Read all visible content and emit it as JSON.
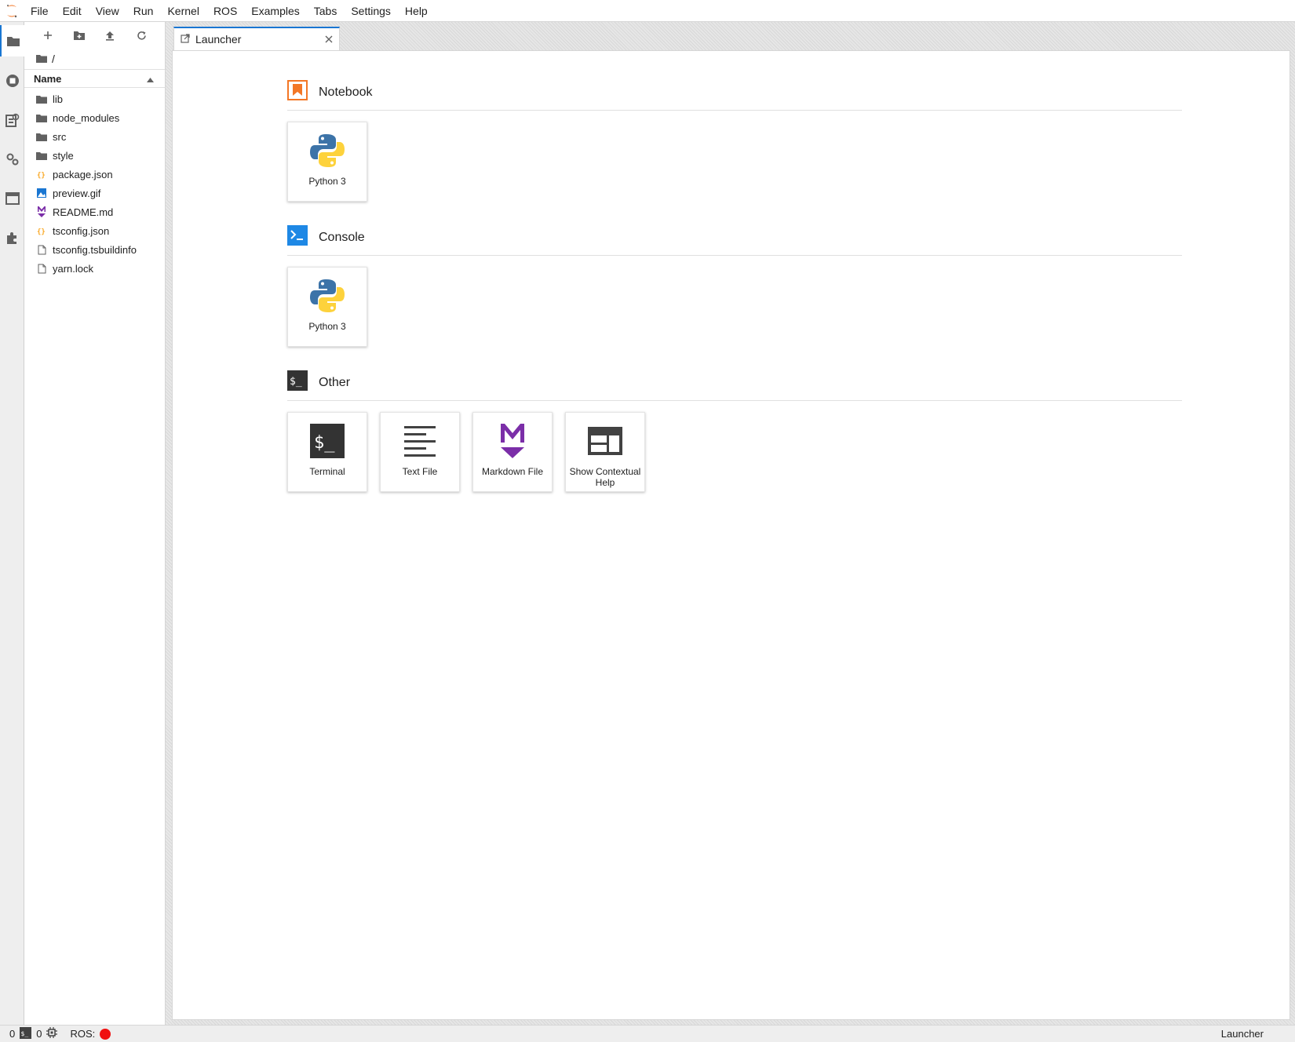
{
  "menubar": {
    "items": [
      "File",
      "Edit",
      "View",
      "Run",
      "Kernel",
      "ROS",
      "Examples",
      "Tabs",
      "Settings",
      "Help"
    ]
  },
  "file_browser": {
    "breadcrumb": "/",
    "column_header": "Name",
    "files": [
      {
        "name": "lib",
        "icon": "folder-icon"
      },
      {
        "name": "node_modules",
        "icon": "folder-icon"
      },
      {
        "name": "src",
        "icon": "folder-icon"
      },
      {
        "name": "style",
        "icon": "folder-icon"
      },
      {
        "name": "package.json",
        "icon": "json-file-icon"
      },
      {
        "name": "preview.gif",
        "icon": "image-file-icon"
      },
      {
        "name": "README.md",
        "icon": "markdown-file-icon"
      },
      {
        "name": "tsconfig.json",
        "icon": "json-file-icon"
      },
      {
        "name": "tsconfig.tsbuildinfo",
        "icon": "file-icon"
      },
      {
        "name": "yarn.lock",
        "icon": "file-icon"
      }
    ]
  },
  "tab": {
    "label": "Launcher"
  },
  "launcher": {
    "notebook": {
      "title": "Notebook",
      "cards": [
        "Python 3"
      ]
    },
    "console": {
      "title": "Console",
      "cards": [
        "Python 3"
      ]
    },
    "other": {
      "title": "Other",
      "cards": [
        "Terminal",
        "Text File",
        "Markdown File",
        "Show Contextual Help"
      ]
    }
  },
  "statusbar": {
    "kernels": "0",
    "terminals": "0",
    "ros_label": "ROS:",
    "ros_status_color": "#f01010",
    "right_label": "Launcher"
  },
  "colors": {
    "accent": "#1976d2",
    "notebook_orange": "#f37726",
    "markdown_purple": "#7b2ea8"
  }
}
